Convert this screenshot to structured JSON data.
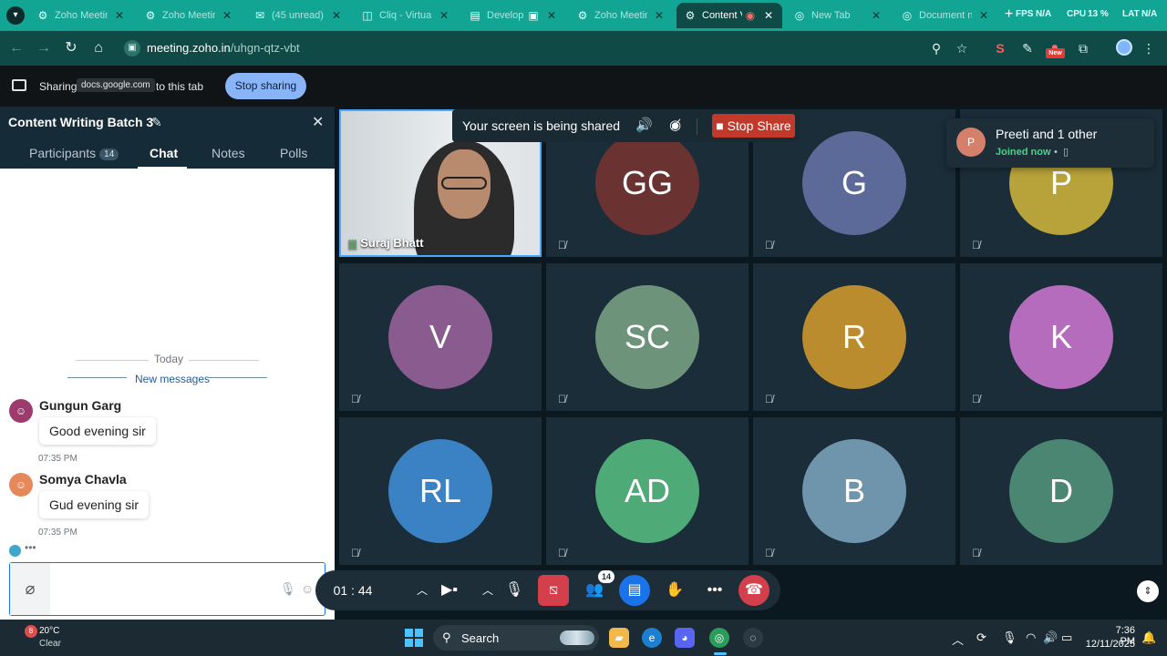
{
  "browser": {
    "tabs": [
      {
        "label": "Zoho Meeting",
        "icon": "zoho-meeting-icon"
      },
      {
        "label": "Zoho Meeting",
        "icon": "zoho-meeting-icon"
      },
      {
        "label": "(45 unread) -",
        "icon": "mail-icon"
      },
      {
        "label": "Cliq - Virtual",
        "icon": "cliq-icon"
      },
      {
        "label": "Develop",
        "icon": "docs-icon"
      },
      {
        "label": "Zoho Meeting",
        "icon": "zoho-meeting-icon"
      },
      {
        "label": "Content V",
        "icon": "zoho-meeting-icon",
        "active": true
      },
      {
        "label": "New Tab",
        "icon": "chrome-icon"
      },
      {
        "label": "Document n",
        "icon": "chrome-icon"
      }
    ],
    "overlay_stats": {
      "fps_label": "FPS",
      "fps_value": "N/A",
      "cpu_label": "CPU",
      "cpu_value": "13 %",
      "lat_label": "LAT",
      "lat_value": "N/A"
    },
    "url_host": "meeting.zoho.in",
    "url_path": "/uhgn-qtz-vbt",
    "new_badge": "New"
  },
  "sharebar": {
    "sharing_label": "Sharing",
    "domain": "docs.google.com",
    "tail": "to this tab",
    "stop_label": "Stop sharing"
  },
  "panel": {
    "title": "Content Writing Batch 3",
    "tabs": {
      "participants": "Participants",
      "participants_count": "14",
      "chat": "Chat",
      "notes": "Notes",
      "polls": "Polls"
    },
    "today": "Today",
    "new_messages": "New messages",
    "messages": [
      {
        "name": "Gungun Garg",
        "text": "Good evening sir",
        "time": "07:35 PM"
      },
      {
        "name": "Somya Chavla",
        "text": "Gud evening sir",
        "time": "07:35 PM"
      }
    ],
    "typing": "•••"
  },
  "meeting": {
    "self_name": "Suraj Bhatt",
    "shared_text": "Your screen is being shared",
    "stop_share": "Stop Share",
    "toast_title": "Preeti and 1 other",
    "toast_sub": "Joined now",
    "toast_avatar": "P",
    "tiles": [
      {
        "initials": "GG",
        "color": "#6b3232"
      },
      {
        "initials": "G",
        "color": "#5c6a99"
      },
      {
        "initials": "P",
        "color": "#b7a33a"
      },
      {
        "initials": "V",
        "color": "#8a5b8f"
      },
      {
        "initials": "SC",
        "color": "#6d947a"
      },
      {
        "initials": "R",
        "color": "#ba8c2d"
      },
      {
        "initials": "K",
        "color": "#b56cbd"
      },
      {
        "initials": "RL",
        "color": "#3a82c4"
      },
      {
        "initials": "AD",
        "color": "#4eaa76"
      },
      {
        "initials": "B",
        "color": "#6f95ad"
      },
      {
        "initials": "D",
        "color": "#4a8672"
      }
    ],
    "timer": "01 : 44",
    "participants_badge": "14"
  },
  "taskbar": {
    "weather_temp": "20°C",
    "weather_state": "Clear",
    "weather_badge": "8",
    "search": "Search",
    "time": "7:36 PM",
    "date": "12/11/2025"
  }
}
